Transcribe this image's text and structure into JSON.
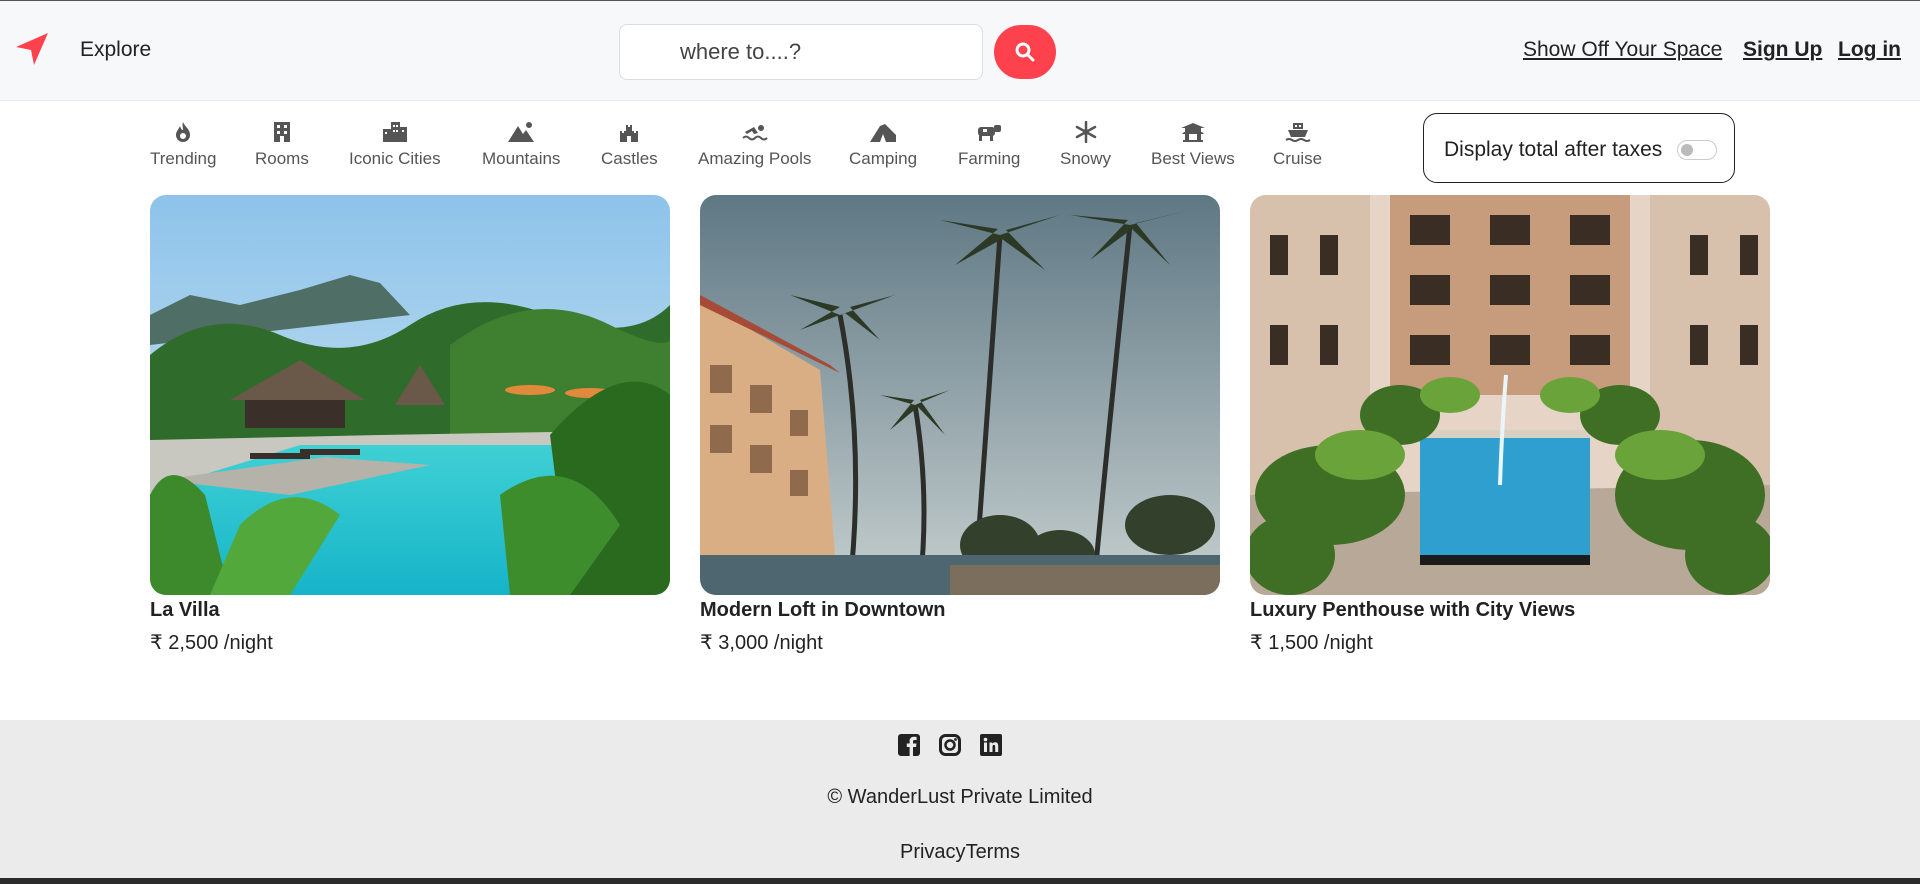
{
  "navbar": {
    "logo_icon": "compass-arrow-icon",
    "explore_label": "Explore",
    "search": {
      "placeholder": "where to....?",
      "value": "",
      "button_icon": "search-icon"
    },
    "host_label": "Show Off Your Space",
    "signup_label": "Sign Up",
    "login_label": "Log in"
  },
  "filters": [
    {
      "label": "Trending",
      "icon": "fire-icon"
    },
    {
      "label": "Rooms",
      "icon": "building-icon"
    },
    {
      "label": "Iconic Cities",
      "icon": "city-icon"
    },
    {
      "label": "Mountains",
      "icon": "mountain-icon"
    },
    {
      "label": "Castles",
      "icon": "castle-icon"
    },
    {
      "label": "Amazing Pools",
      "icon": "swimmer-icon"
    },
    {
      "label": "Camping",
      "icon": "tent-icon"
    },
    {
      "label": "Farming",
      "icon": "cow-icon"
    },
    {
      "label": "Snowy",
      "icon": "snowflake-icon"
    },
    {
      "label": "Best Views",
      "icon": "pagoda-icon"
    },
    {
      "label": "Cruise",
      "icon": "ship-icon"
    }
  ],
  "tax_toggle": {
    "label": "Display total after taxes",
    "checked": false
  },
  "listings": [
    {
      "title": "La Villa",
      "price": "₹ 2,500 /night"
    },
    {
      "title": "Modern Loft in Downtown",
      "price": "₹ 3,000 /night"
    },
    {
      "title": "Luxury Penthouse with City Views",
      "price": "₹ 1,500 /night"
    }
  ],
  "footer": {
    "social_icons": [
      "facebook-icon",
      "instagram-icon",
      "linkedin-icon"
    ],
    "copyright": "© WanderLust Private Limited",
    "privacy_label": "Privacy",
    "terms_label": "Terms"
  },
  "colors": {
    "accent": "#fe424d",
    "footer_bg": "#ebebeb",
    "nav_bg": "#f7f8fa"
  }
}
